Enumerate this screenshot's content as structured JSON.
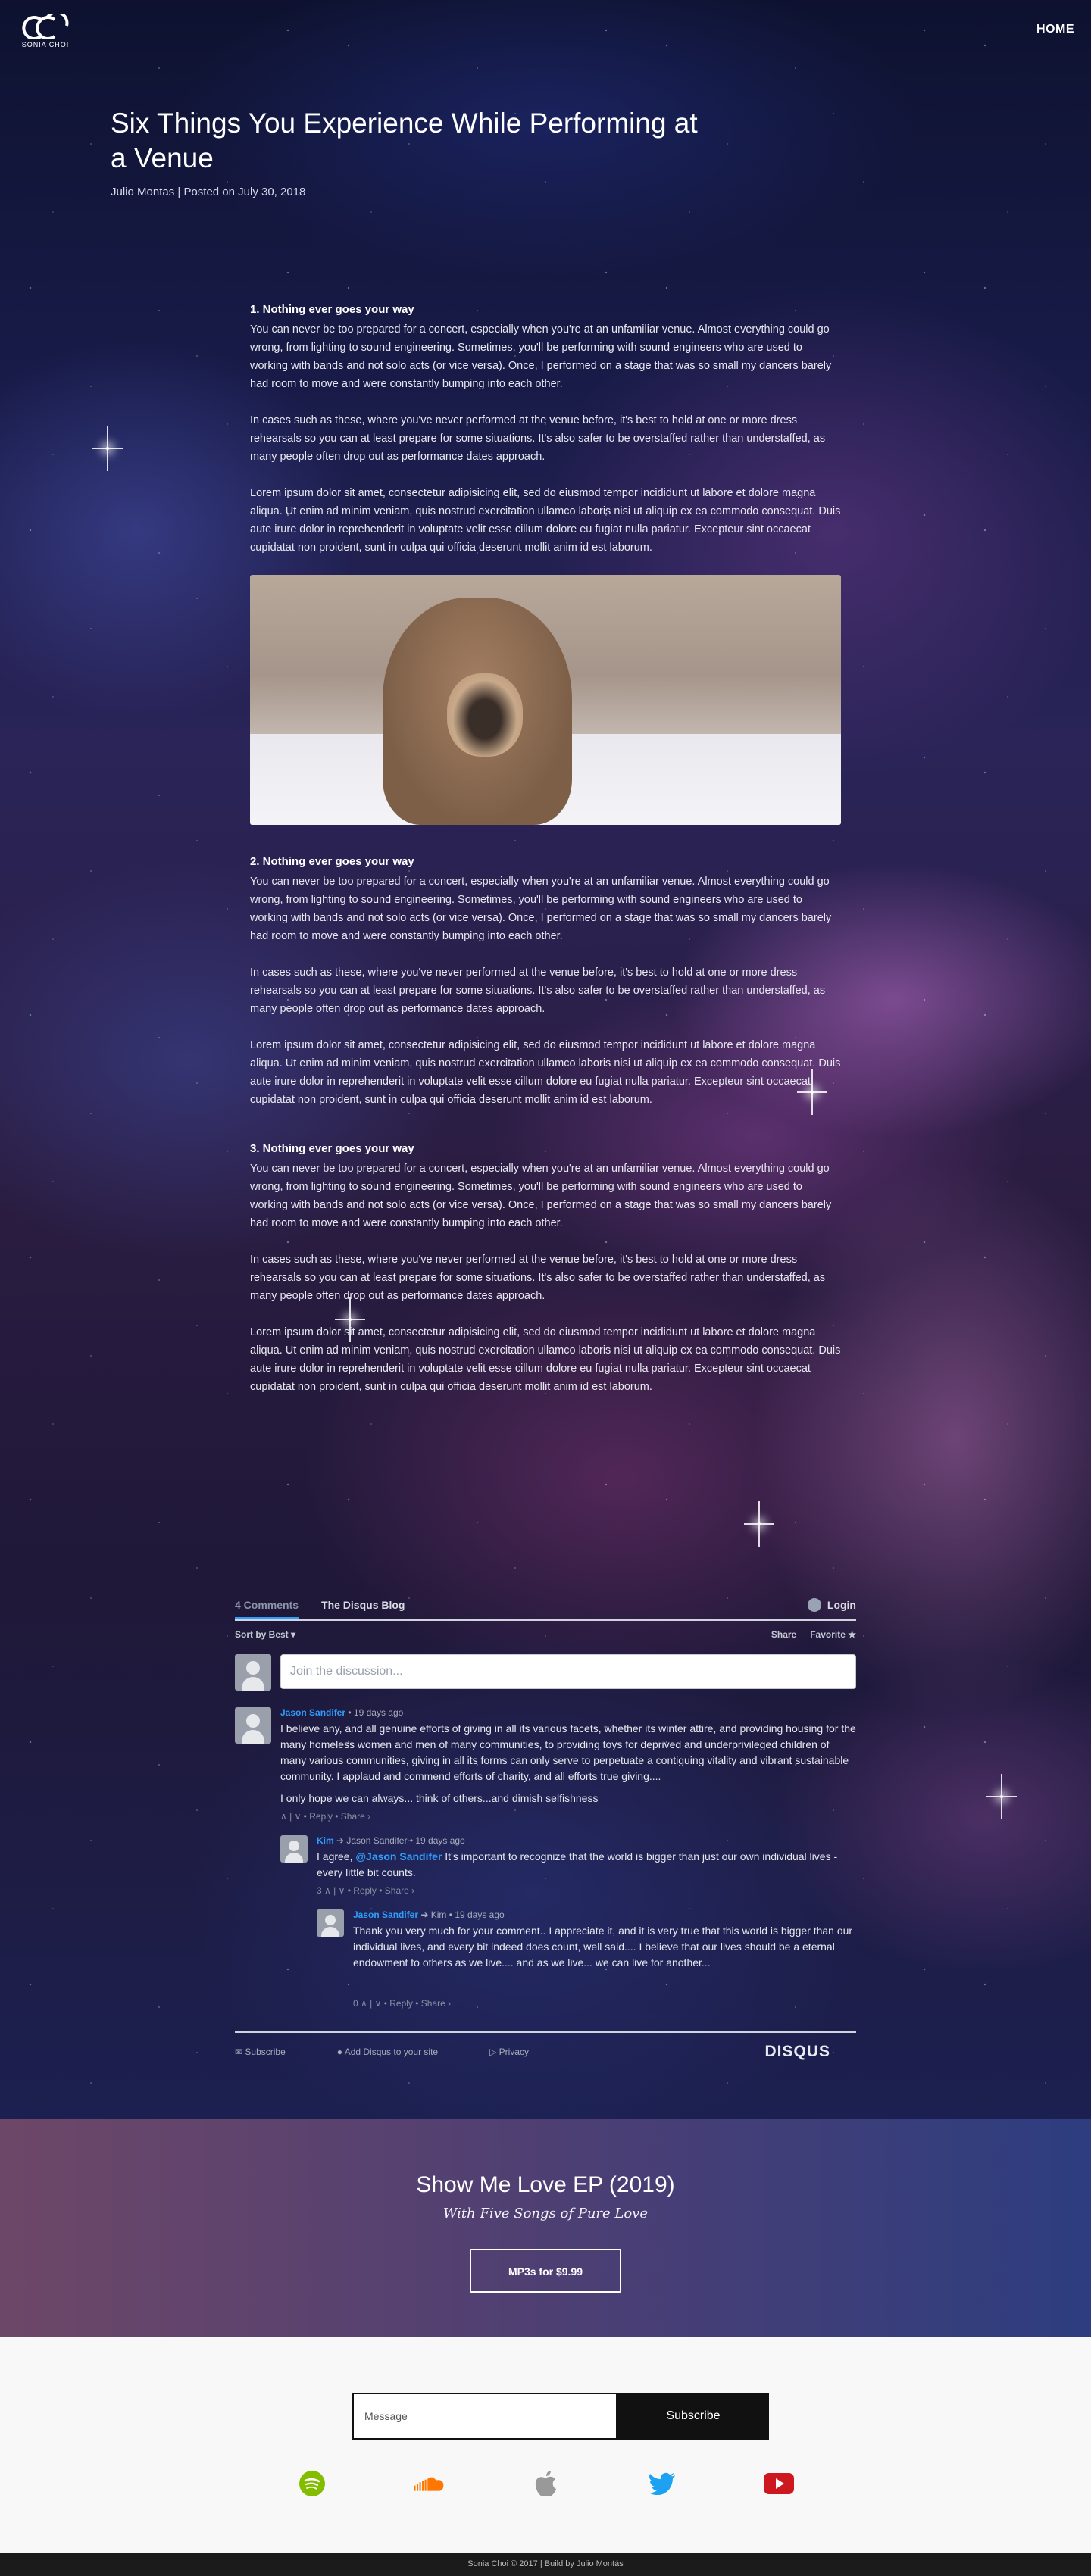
{
  "nav": {
    "logo_text": "SONIA CHOI",
    "home_label": "HOME"
  },
  "post": {
    "title": "Six Things You Experience While Performing at a Venue",
    "meta": "Julio Montas | Posted on July 30, 2018"
  },
  "sections": [
    {
      "heading": "1. Nothing ever goes your way",
      "p1": "You can never be too prepared for a concert, especially when you're at an unfamiliar venue. Almost everything could go wrong, from lighting to sound engineering. Sometimes, you'll be performing with sound engineers who are used to working with bands and not solo acts (or vice versa). Once, I performed on a stage that was so small my dancers barely had room to move and were constantly bumping into each other.",
      "p2": "In cases such as these, where you've never performed at the venue before, it's best to hold at one or more dress rehearsals so you can at least prepare for some situations. It's also safer to be overstaffed rather than understaffed, as many people often drop out as performance dates approach.",
      "p3": "Lorem ipsum dolor sit amet, consectetur adipisicing elit, sed do eiusmod tempor incididunt ut labore et dolore magna aliqua. Ut enim ad minim veniam, quis nostrud exercitation ullamco laboris nisi ut aliquip ex ea commodo consequat. Duis aute irure dolor in reprehenderit in voluptate velit esse cillum dolore eu fugiat nulla pariatur. Excepteur sint occaecat cupidatat non proident, sunt in culpa qui officia deserunt mollit anim id est laborum."
    },
    {
      "heading": "2. Nothing ever goes your way",
      "p1": "You can never be too prepared for a concert, especially when you're at an unfamiliar venue. Almost everything could go wrong, from lighting to sound engineering. Sometimes, you'll be performing with sound engineers who are used to working with bands and not solo acts (or vice versa). Once, I performed on a stage that was so small my dancers barely had room to move and were constantly bumping into each other.",
      "p2": "In cases such as these, where you've never performed at the venue before, it's best to hold at one or more dress rehearsals so you can at least prepare for some situations. It's also safer to be overstaffed rather than understaffed, as many people often drop out as performance dates approach.",
      "p3": "Lorem ipsum dolor sit amet, consectetur adipisicing elit, sed do eiusmod tempor incididunt ut labore et dolore magna aliqua. Ut enim ad minim veniam, quis nostrud exercitation ullamco laboris nisi ut aliquip ex ea commodo consequat. Duis aute irure dolor in reprehenderit in voluptate velit esse cillum dolore eu fugiat nulla pariatur. Excepteur sint occaecat cupidatat non proident, sunt in culpa qui officia deserunt mollit anim id est laborum."
    },
    {
      "heading": "3. Nothing ever goes your way",
      "p1": "You can never be too prepared for a concert, especially when you're at an unfamiliar venue. Almost everything could go wrong, from lighting to sound engineering. Sometimes, you'll be performing with sound engineers who are used to working with bands and not solo acts (or vice versa). Once, I performed on a stage that was so small my dancers barely had room to move and were constantly bumping into each other.",
      "p2": "In cases such as these, where you've never performed at the venue before, it's best to hold at one or more dress rehearsals so you can at least prepare for some situations. It's also safer to be overstaffed rather than understaffed, as many people often drop out as performance dates approach.",
      "p3": "Lorem ipsum dolor sit amet, consectetur adipisicing elit, sed do eiusmod tempor incididunt ut labore et dolore magna aliqua. Ut enim ad minim veniam, quis nostrud exercitation ullamco laboris nisi ut aliquip ex ea commodo consequat. Duis aute irure dolor in reprehenderit in voluptate velit esse cillum dolore eu fugiat nulla pariatur. Excepteur sint occaecat cupidatat non proident, sunt in culpa qui officia deserunt mollit anim id est laborum."
    }
  ],
  "disqus": {
    "tab_comments": "4 Comments",
    "tab_blog": "The Disqus Blog",
    "login": "Login",
    "sort": "Sort by Best ▾",
    "share": "Share",
    "favorite": "Favorite ★",
    "placeholder": "Join the discussion...",
    "comments": [
      {
        "author": "Jason Sandifer",
        "time": "• 19 days ago",
        "text1": "I believe any, and all genuine efforts of giving in all its various facets, whether its winter attire, and providing housing for the many homeless women and men of many communities, to providing toys for deprived and underprivileged children of many various communities, giving in all its forms can only serve to perpetuate a contiguing vitality and vibrant sustainable community. I applaud and commend efforts of charity, and all efforts true giving....",
        "text2": "I only hope we can always... think of others...and dimish selfishness",
        "actions": "∧ | ∨ • Reply • Share ›"
      },
      {
        "author": "Kim",
        "reply_to": "➔ Jason Sandifer",
        "time": "• 19 days ago",
        "mention": "@Jason Sandifer",
        "text_pre": "I agree,",
        "text": "It's important to recognize that the world is bigger than just our own individual lives - every little bit counts.",
        "actions": "3 ∧ | ∨ • Reply • Share ›"
      },
      {
        "author": "Jason Sandifer",
        "reply_to": "➔ Kim",
        "time": "• 19 days ago",
        "text": "Thank you very much for your comment.. I appreciate it, and it is very true that this world is bigger than our individual lives, and every bit indeed does count, well said.... I believe that our lives should be a eternal endowment to others as we live.... and as we live... we can live for another...",
        "actions": "0 ∧ | ∨ • Reply • Share ›"
      }
    ],
    "footer_subscribe": "Subscribe",
    "footer_add": "Add Disqus to your site",
    "footer_privacy": "Privacy",
    "brand": "DISQUS"
  },
  "ep": {
    "title": "Show Me Love EP (2019)",
    "subtitle": "With Five Songs of Pure Love",
    "button": "MP3s for $9.99"
  },
  "newsletter": {
    "placeholder": "Message",
    "button": "Subscribe"
  },
  "socials": [
    {
      "icon": "spotify-icon",
      "color": "#84bd00"
    },
    {
      "icon": "soundcloud-icon",
      "color": "#ff7700"
    },
    {
      "icon": "apple-icon",
      "color": "#999999"
    },
    {
      "icon": "twitter-icon",
      "color": "#1da1f2"
    },
    {
      "icon": "youtube-icon",
      "color": "#cc181e"
    }
  ],
  "footer": {
    "text": "Sonia Choi © 2017 | Build by Julio Montás"
  }
}
